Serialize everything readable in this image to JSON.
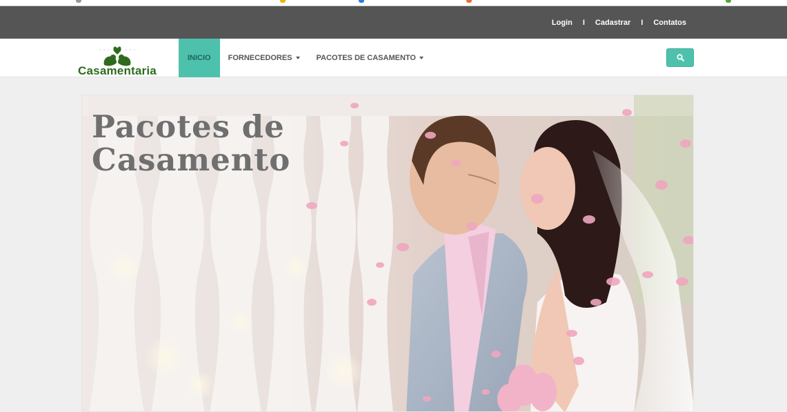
{
  "topbar": {
    "links": [
      {
        "label": "Login"
      },
      {
        "label": "Cadastrar"
      },
      {
        "label": "Contatos"
      }
    ],
    "separator": "I"
  },
  "brand": {
    "name": "Casamentaria",
    "color": "#2e6b1d"
  },
  "nav": {
    "items": [
      {
        "label": "INICIO",
        "active": true
      },
      {
        "label": "FORNECEDORES",
        "dropdown": true
      },
      {
        "label": "PACOTES DE CASAMENTO",
        "dropdown": true
      }
    ],
    "search_icon": "search-icon"
  },
  "hero": {
    "title_line1": "Pacotes de",
    "title_line2": "Casamento"
  },
  "colors": {
    "accent": "#4ec1ad",
    "topbar": "#555555",
    "page_bg": "#efefef"
  }
}
